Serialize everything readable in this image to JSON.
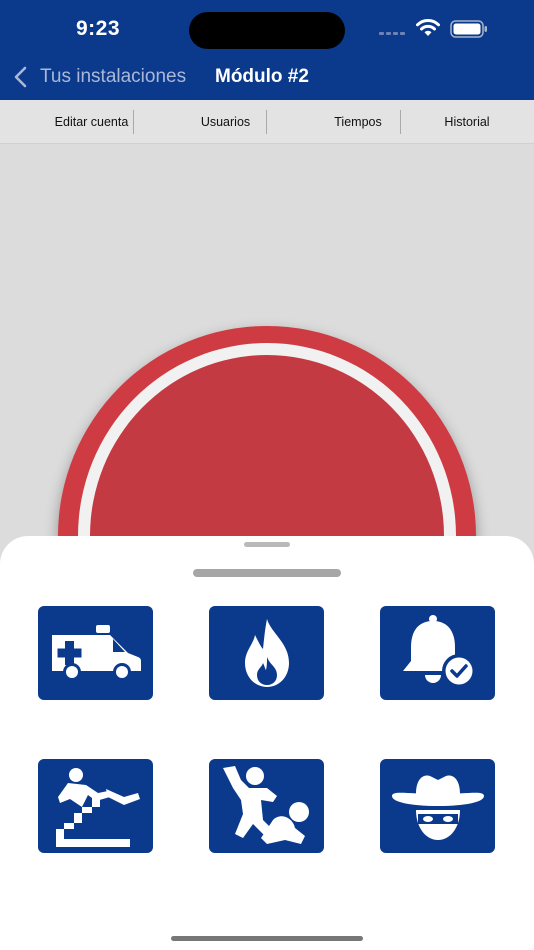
{
  "status_bar": {
    "time": "9:23",
    "icons": [
      "cellular-signal-icon",
      "wifi-icon",
      "battery-icon"
    ]
  },
  "nav": {
    "back_label": "Tus instalaciones",
    "title": "Módulo #2",
    "back_icon": "chevron-left-icon"
  },
  "tabs": [
    {
      "label": "Editar cuenta"
    },
    {
      "label": "Usuarios"
    },
    {
      "label": "Tiempos"
    },
    {
      "label": "Historial"
    }
  ],
  "panic_button": {
    "icon": "panic-button"
  },
  "emergency_options": [
    {
      "icon": "ambulance-icon"
    },
    {
      "icon": "fire-icon"
    },
    {
      "icon": "alarm-bell-check-icon"
    },
    {
      "icon": "fall-stairs-icon"
    },
    {
      "icon": "assault-icon"
    },
    {
      "icon": "masked-intruder-icon"
    }
  ],
  "colors": {
    "brand_blue": "#0b3a8c",
    "panic_red": "#c43a42",
    "background_gray": "#dcdcdc"
  }
}
